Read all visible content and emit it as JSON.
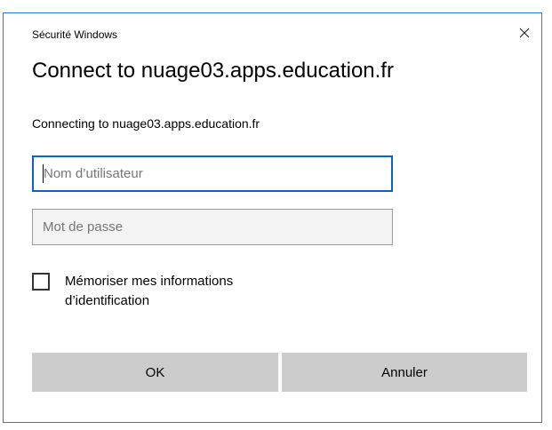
{
  "window": {
    "app_title": "Sécurité Windows",
    "close_icon": "close-icon"
  },
  "header": {
    "title": "Connect to nuage03.apps.education.fr",
    "subtitle": "Connecting to nuage03.apps.education.fr"
  },
  "form": {
    "username": {
      "value": "",
      "placeholder": "Nom d’utilisateur"
    },
    "password": {
      "value": "",
      "placeholder": "Mot de passe"
    },
    "remember": {
      "label": "Mémoriser mes informations d’identification",
      "checked": false
    }
  },
  "buttons": {
    "ok_label": "OK",
    "cancel_label": "Annuler"
  },
  "colors": {
    "window_border": "#1883d7",
    "focus_border": "#0a64c8",
    "button_bg": "#cccccc"
  }
}
